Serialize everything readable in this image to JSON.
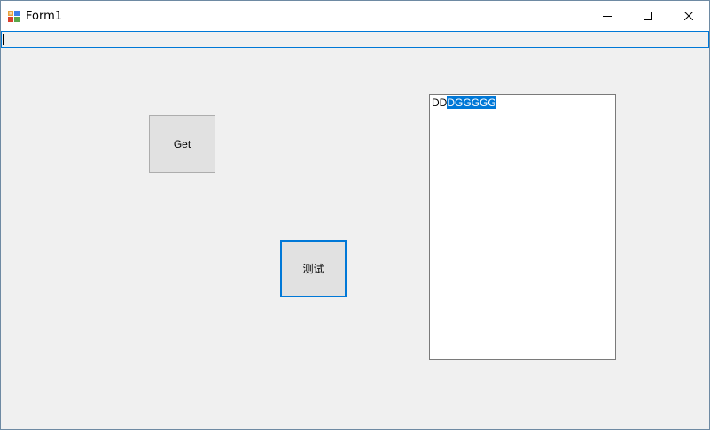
{
  "window": {
    "title": "Form1"
  },
  "top_input": {
    "value": ""
  },
  "buttons": {
    "get_label": "Get",
    "test_label": "测试"
  },
  "textbox": {
    "plain_text": "DD",
    "selected_text": "DGGGGG"
  },
  "colors": {
    "accent": "#0078d7",
    "background": "#f0f0f0",
    "button_face": "#e1e1e1"
  },
  "icons": {
    "app": "form-app-icon",
    "minimize": "minimize-icon",
    "maximize": "maximize-icon",
    "close": "close-icon"
  }
}
